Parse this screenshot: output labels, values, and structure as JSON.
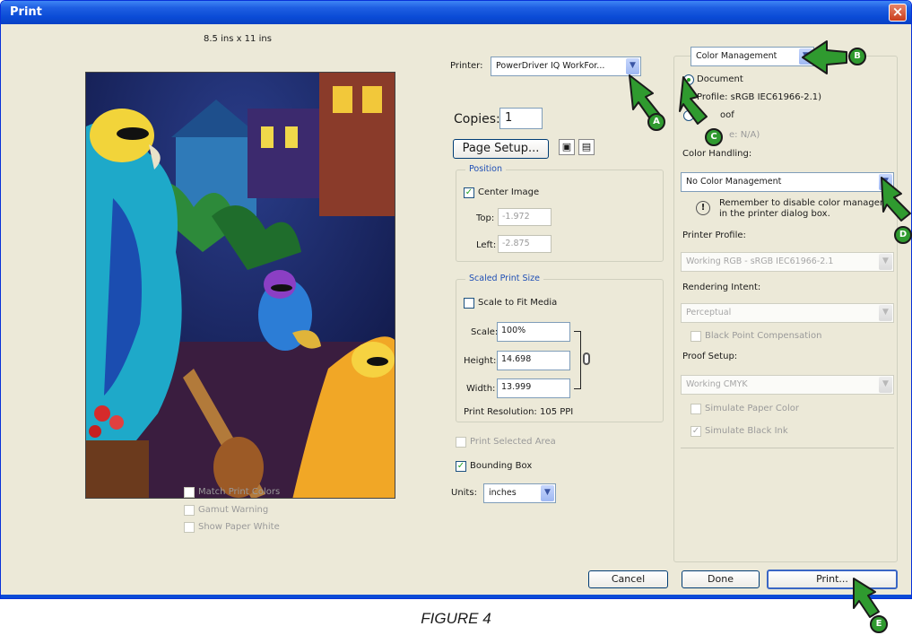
{
  "window": {
    "title": "Print",
    "close_label": "×"
  },
  "preview": {
    "paper_size": "8.5 ins x 11 ins",
    "options": [
      {
        "label": "Match Print Colors",
        "checked": false
      },
      {
        "label": "Gamut Warning",
        "checked": false
      },
      {
        "label": "Show Paper White",
        "checked": false
      }
    ]
  },
  "printer": {
    "label": "Printer:",
    "value": "PowerDriver IQ WorkFor..."
  },
  "copies": {
    "label": "Copies:",
    "value": "1"
  },
  "page_setup_label": "Page Setup...",
  "position": {
    "title": "Position",
    "center_image_label": "Center Image",
    "top_label": "Top:",
    "top_value": "-1.972",
    "left_label": "Left:",
    "left_value": "-2.875"
  },
  "scaled": {
    "title": "Scaled Print Size",
    "scale_to_fit_label": "Scale to Fit Media",
    "scale_label": "Scale:",
    "scale_value": "100%",
    "height_label": "Height:",
    "height_value": "14.698",
    "width_label": "Width:",
    "width_value": "13.999",
    "resolution": "Print Resolution: 105 PPI"
  },
  "print_selected_area_label": "Print Selected Area",
  "bounding_box_label": "Bounding Box",
  "units": {
    "label": "Units:",
    "value": "inches"
  },
  "color_mgmt": {
    "dropdown": "Color Management",
    "document_label": "Document",
    "document_profile": "Profile: sRGB IEC61966-2.1)",
    "proof_label": "oof",
    "proof_profile": "e: N/A)",
    "color_handling_label": "Color Handling:",
    "color_handling_value": "No Color Management",
    "warning": "Remember to disable color managemen in the printer dialog box.",
    "warning_line1": "Remember to disable color managemen",
    "warning_line2": "in the printer dialog box.",
    "printer_profile_label": "Printer Profile:",
    "printer_profile_value": "Working RGB - sRGB IEC61966-2.1",
    "rendering_intent_label": "Rendering Intent:",
    "rendering_intent_value": "Perceptual",
    "black_point_label": "Black Point Compensation",
    "proof_setup_label": "Proof Setup:",
    "proof_setup_value": "Working CMYK",
    "simulate_paper_label": "Simulate Paper Color",
    "simulate_black_label": "Simulate Black Ink"
  },
  "buttons": {
    "cancel": "Cancel",
    "done": "Done",
    "print": "Print..."
  },
  "callouts": [
    "A",
    "B",
    "C",
    "D",
    "E"
  ],
  "caption": "FIGURE 4",
  "colors": {
    "callout_green": "#2f9a2f",
    "title_blue": "#0a4bd6",
    "check_green": "#21a121"
  }
}
